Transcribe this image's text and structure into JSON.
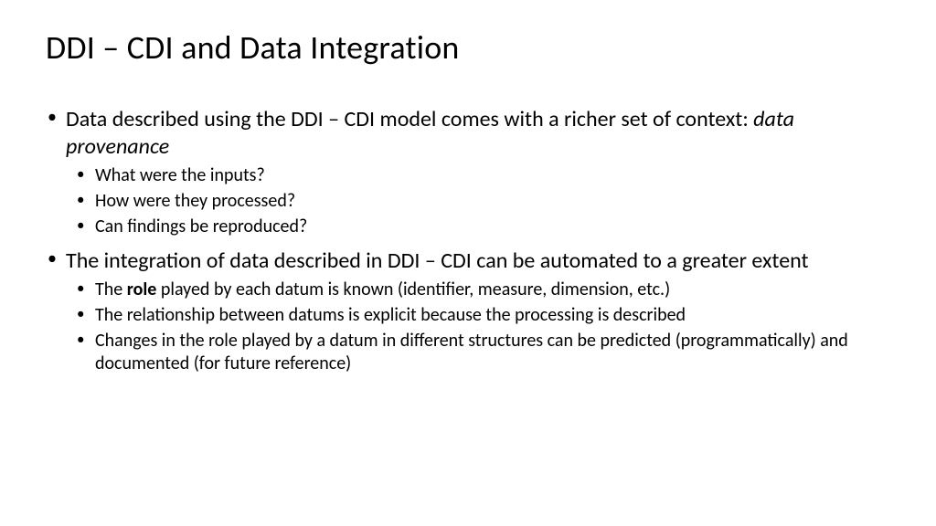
{
  "title": "DDI – CDI and Data Integration",
  "bullets": {
    "b1_pre": "Data described using the DDI – CDI model comes with a richer set of context: ",
    "b1_italic": "data provenance",
    "b1_sub1": "What were the inputs?",
    "b1_sub2": "How were they processed?",
    "b1_sub3": "Can findings be reproduced?",
    "b2": "The integration of data described in DDI – CDI can be automated to a greater extent",
    "b2_sub1_pre": "The ",
    "b2_sub1_bold": "role",
    "b2_sub1_post": " played by each datum is known (identifier, measure, dimension, etc.)",
    "b2_sub2": "The relationship between datums is explicit because the processing is described",
    "b2_sub3": "Changes in the role played by a datum in different structures can be predicted (programmatically) and documented (for future reference)"
  }
}
